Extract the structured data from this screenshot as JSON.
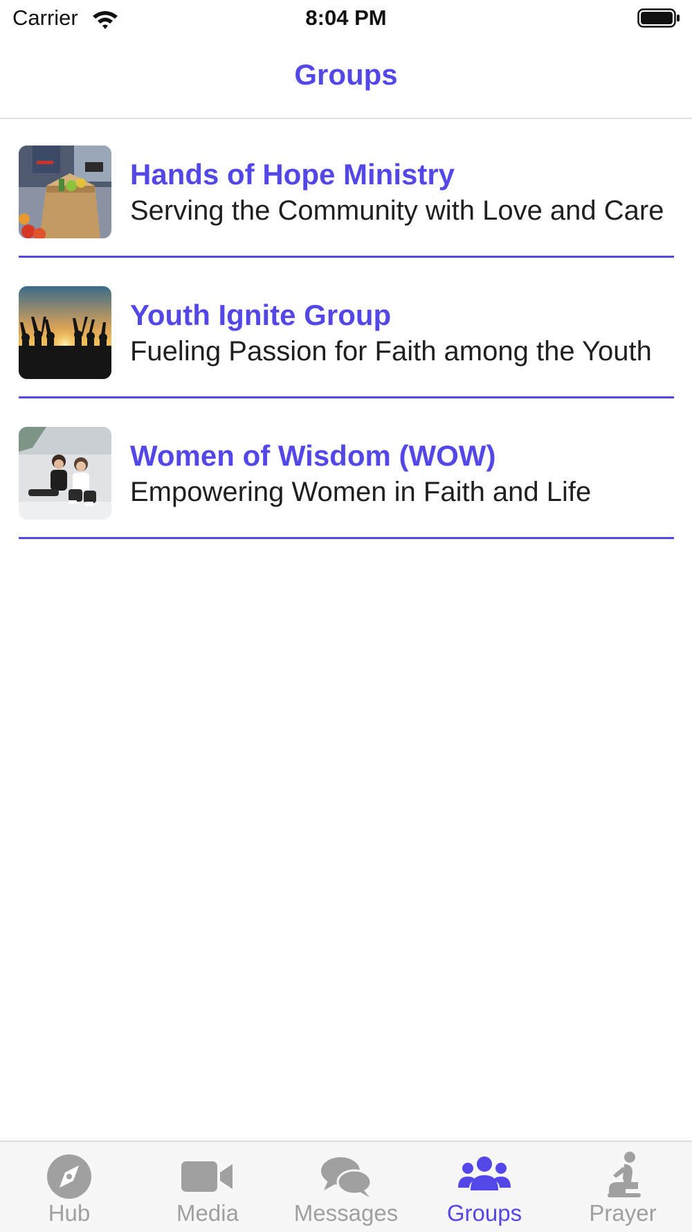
{
  "status_bar": {
    "carrier": "Carrier",
    "time": "8:04 PM"
  },
  "nav": {
    "title": "Groups"
  },
  "groups": [
    {
      "name": "Hands of Hope Ministry",
      "description": "Serving the Community with Love and Care",
      "image": "food-donation-box-photo"
    },
    {
      "name": "Youth Ignite Group",
      "description": "Fueling Passion for Faith among the Youth",
      "image": "sunset-silhouettes-photo"
    },
    {
      "name": "Women of Wisdom (WOW)",
      "description": "Empowering Women in Faith and Life",
      "image": "two-women-sitting-photo"
    }
  ],
  "tabs": [
    {
      "label": "Hub",
      "icon": "compass-icon",
      "active": false
    },
    {
      "label": "Media",
      "icon": "video-camera-icon",
      "active": false
    },
    {
      "label": "Messages",
      "icon": "chat-bubbles-icon",
      "active": false
    },
    {
      "label": "Groups",
      "icon": "people-group-icon",
      "active": true
    },
    {
      "label": "Prayer",
      "icon": "praying-person-icon",
      "active": false
    }
  ],
  "colors": {
    "accent": "#5447e8",
    "inactive_tab": "#a0a0a0"
  }
}
